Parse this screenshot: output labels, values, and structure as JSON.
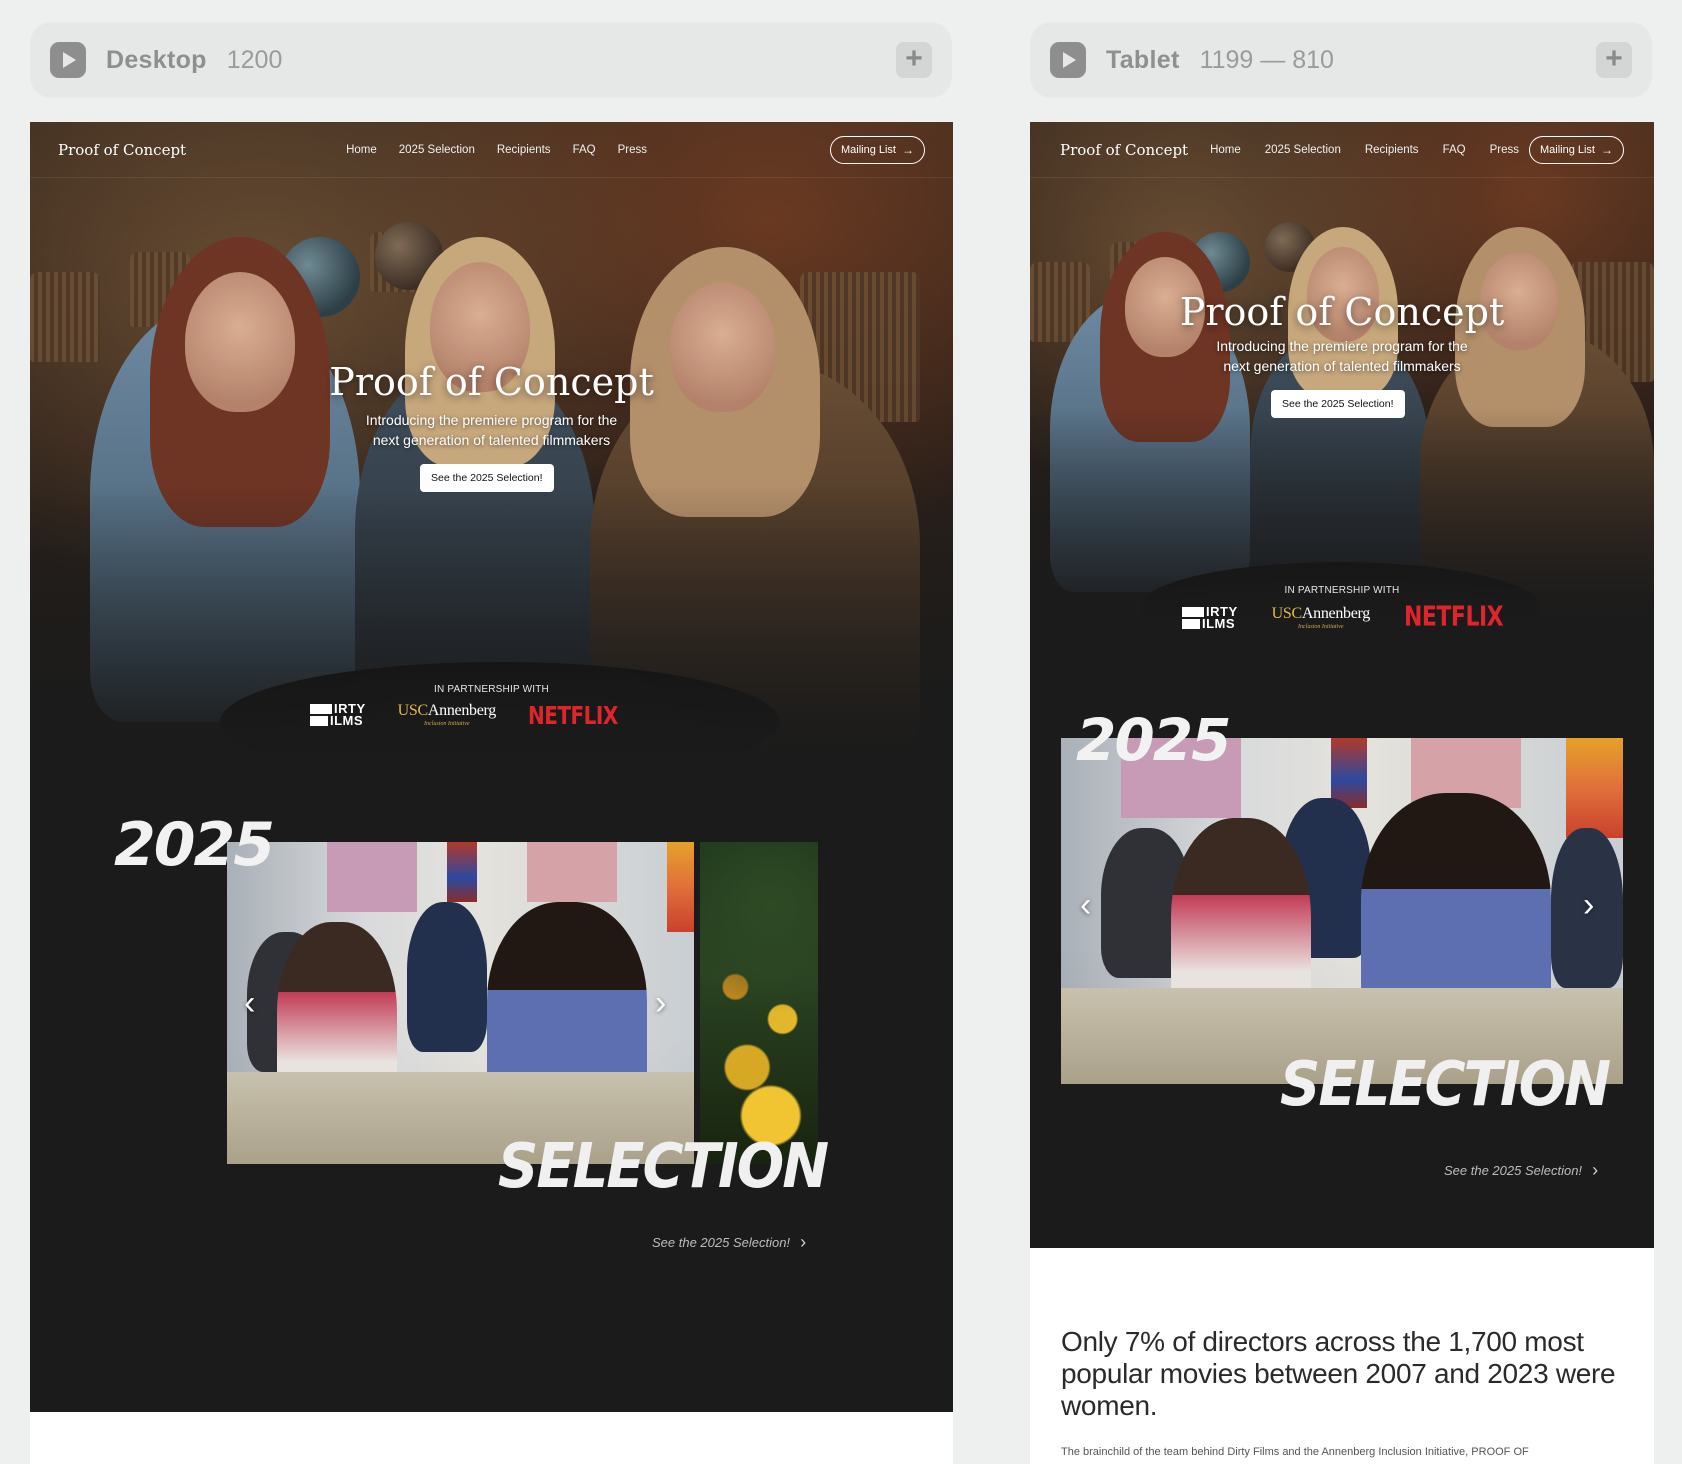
{
  "breakpoints": {
    "desktop": {
      "name": "Desktop",
      "size": "1200"
    },
    "tablet": {
      "name": "Tablet",
      "size": "1199 — 810"
    }
  },
  "site": {
    "brand": "Proof of Concept",
    "nav": [
      "Home",
      "2025 Selection",
      "Recipients",
      "FAQ",
      "Press"
    ],
    "mailing_button": "Mailing List",
    "hero": {
      "title": "Proof of Concept",
      "subtitle_line1": "Introducing the premiere program for the",
      "subtitle_line2": "next generation of talented filmmakers",
      "cta": "See the 2025 Selection!"
    },
    "partnership_label": "IN PARTNERSHIP WITH",
    "partners": {
      "dirty": {
        "line1": "IRTY",
        "line2": "ILMS"
      },
      "usc": {
        "usc": "USC",
        "annenberg": "Annenberg",
        "sub": "Inclusion Initiative"
      },
      "netflix": "NETFLIX"
    },
    "selection": {
      "year": "2025",
      "word": "SELECTION",
      "link": "See the 2025 Selection!"
    },
    "stat": {
      "heading": "Only 7% of directors across the 1,700 most popular movies between 2007 and 2023 were women.",
      "body": "The brainchild of the team behind Dirty Films and the Annenberg Inclusion Initiative, PROOF OF"
    }
  },
  "icons": {
    "play": "play-icon",
    "plus": "plus-icon",
    "arrow": "arrow-right-icon",
    "prev": "chevron-left-icon",
    "next": "chevron-right-icon"
  },
  "colors": {
    "canvas": "#eef0f0",
    "page_bg": "#1b1b1b",
    "netflix_red": "#e0242c",
    "usc_gold": "#e2b94a"
  }
}
